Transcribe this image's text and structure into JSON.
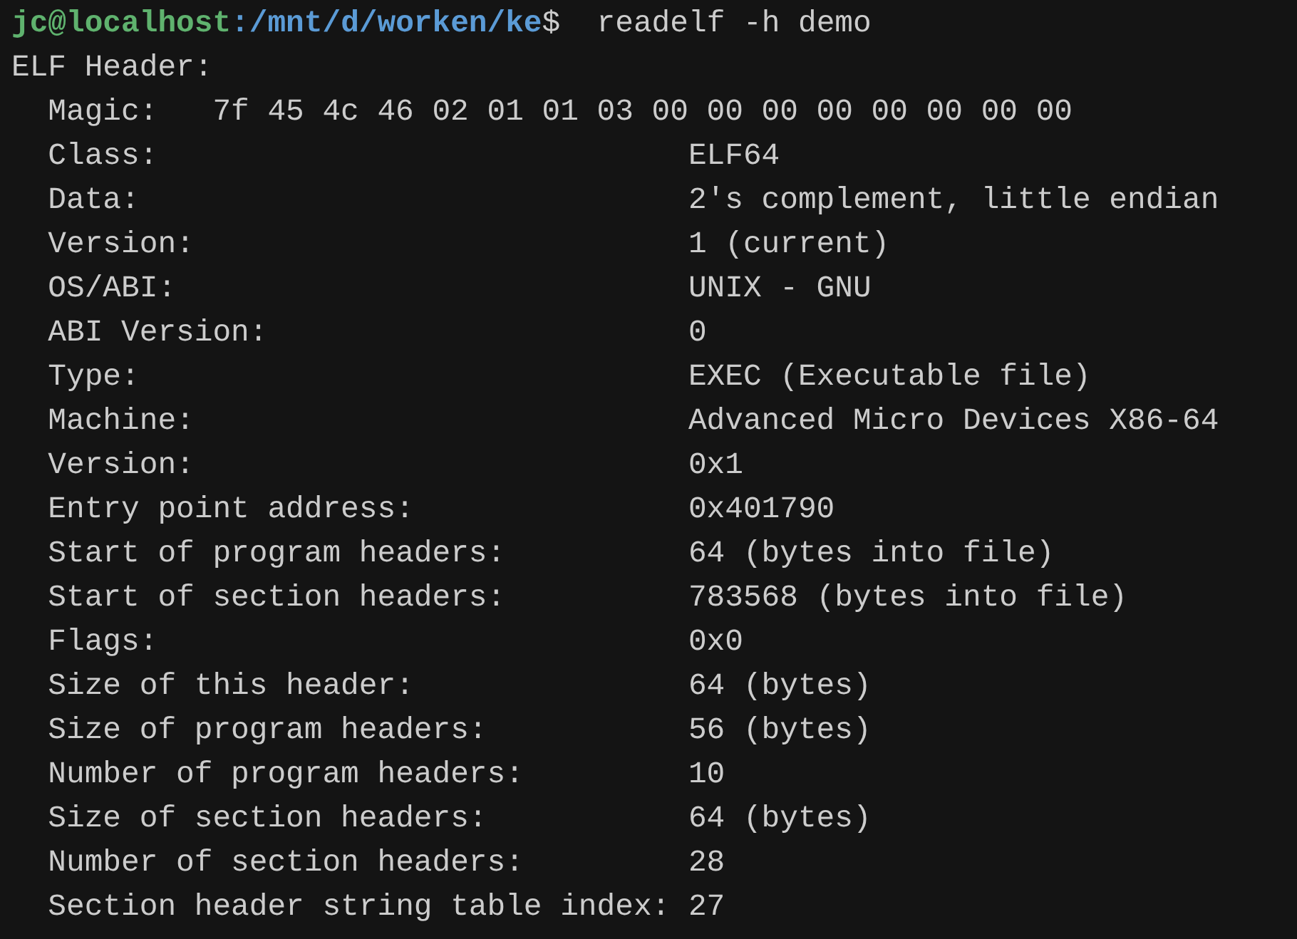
{
  "prompt": {
    "user_host": "jc@localhost",
    "separator": ":",
    "path": "/mnt/d/worken/ke",
    "symbol": "$",
    "command": "readelf -h demo"
  },
  "header_title": "ELF Header:",
  "magic": {
    "label": "Magic:",
    "value": "7f 45 4c 46 02 01 01 03 00 00 00 00 00 00 00 00"
  },
  "fields": [
    {
      "label": "Class:",
      "value": "ELF64"
    },
    {
      "label": "Data:",
      "value": "2's complement, little endian"
    },
    {
      "label": "Version:",
      "value": "1 (current)"
    },
    {
      "label": "OS/ABI:",
      "value": "UNIX - GNU"
    },
    {
      "label": "ABI Version:",
      "value": "0"
    },
    {
      "label": "Type:",
      "value": "EXEC (Executable file)"
    },
    {
      "label": "Machine:",
      "value": "Advanced Micro Devices X86-64"
    },
    {
      "label": "Version:",
      "value": "0x1"
    },
    {
      "label": "Entry point address:",
      "value": "0x401790"
    },
    {
      "label": "Start of program headers:",
      "value": "64 (bytes into file)"
    },
    {
      "label": "Start of section headers:",
      "value": "783568 (bytes into file)"
    },
    {
      "label": "Flags:",
      "value": "0x0"
    },
    {
      "label": "Size of this header:",
      "value": "64 (bytes)"
    },
    {
      "label": "Size of program headers:",
      "value": "56 (bytes)"
    },
    {
      "label": "Number of program headers:",
      "value": "10"
    },
    {
      "label": "Size of section headers:",
      "value": "64 (bytes)"
    },
    {
      "label": "Number of section headers:",
      "value": "28"
    },
    {
      "label": "Section header string table index:",
      "value": "27"
    }
  ]
}
